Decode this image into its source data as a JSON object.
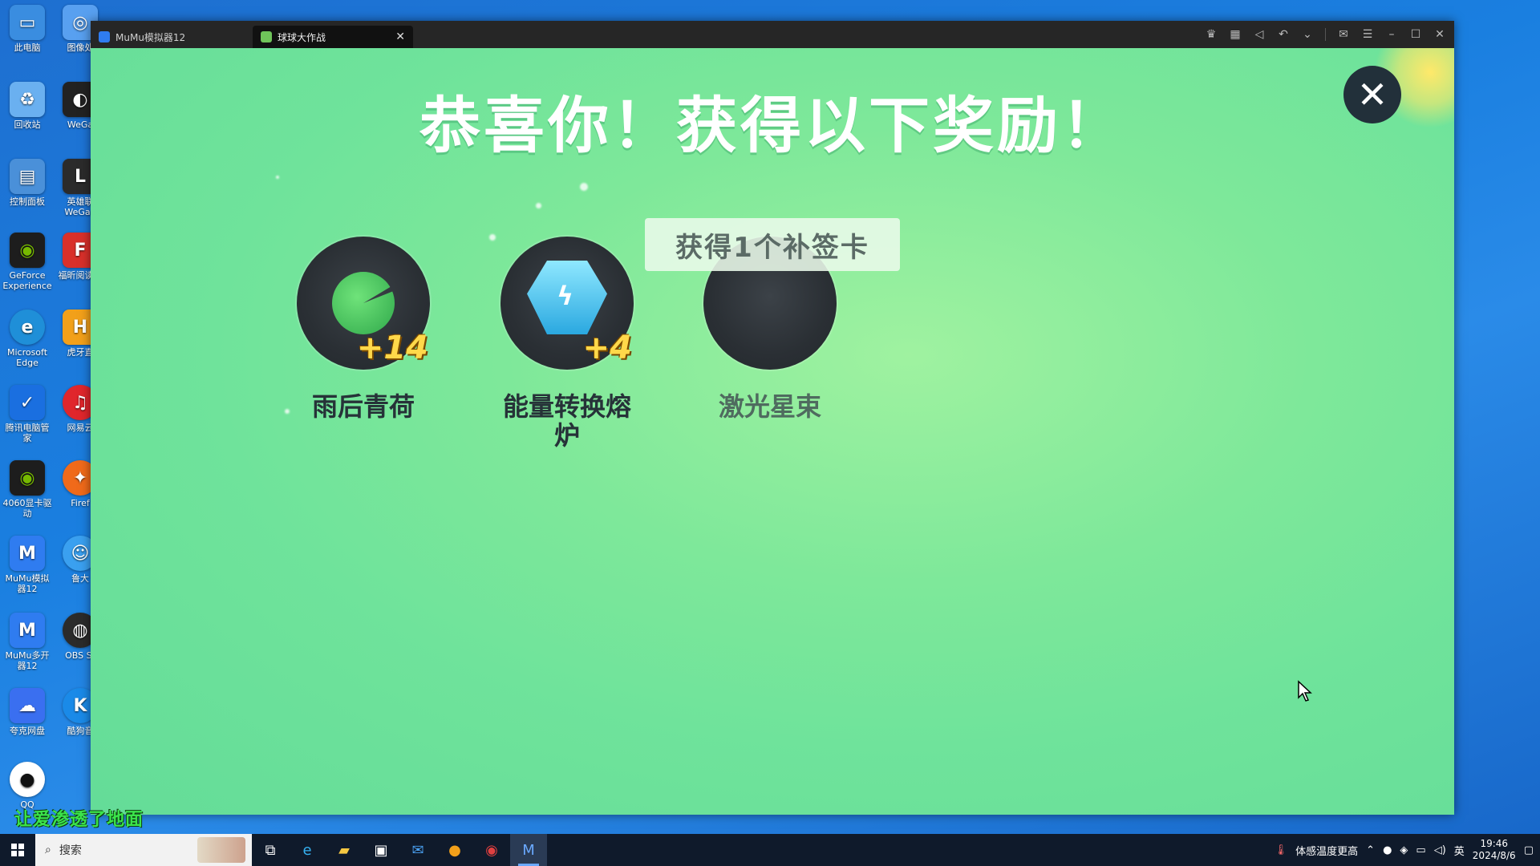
{
  "desktop": {
    "icons": [
      {
        "label": "此电脑",
        "color": "#3a8de0"
      },
      {
        "label": "图像处",
        "color": "#58a0f0"
      },
      {
        "label": "回收站",
        "color": "#6ab0f0"
      },
      {
        "label": "WeGa",
        "color": "#222222"
      },
      {
        "label": "控制面板",
        "color": "#4a90d9"
      },
      {
        "label": "英雄联 WeGan",
        "color": "#2b2b2b"
      },
      {
        "label": "GeForce Experience",
        "color": "#1d1d1d"
      },
      {
        "label": "福昕阅读器",
        "color": "#d9302a"
      },
      {
        "label": "Microsoft Edge",
        "color": "#1f8fd8"
      },
      {
        "label": "虎牙直",
        "color": "#f2a01a"
      },
      {
        "label": "腾讯电脑管家",
        "color": "#1a6fe0"
      },
      {
        "label": "网易云",
        "color": "#e0262c"
      },
      {
        "label": "4060显卡驱动",
        "color": "#1d1d1d"
      },
      {
        "label": "Firef",
        "color": "#f06a1a"
      },
      {
        "label": "MuMu模拟器12",
        "color": "#2f7cf0"
      },
      {
        "label": "鲁大",
        "color": "#3aa0f0"
      },
      {
        "label": "MuMu多开器12",
        "color": "#2f7cf0"
      },
      {
        "label": "OBS St",
        "color": "#2b2b2b"
      },
      {
        "label": "夸克网盘",
        "color": "#3a6ff0"
      },
      {
        "label": "酷狗音",
        "color": "#1a8ae8"
      },
      {
        "label": "QQ",
        "color": "#111111"
      }
    ]
  },
  "window": {
    "tabs": [
      {
        "label": "MuMu模拟器12"
      },
      {
        "label": "球球大作战"
      }
    ],
    "toolbar_icons": [
      "gamepad-icon",
      "keyboard-icon",
      "volume-icon",
      "undo-icon",
      "chevron-down-icon",
      "mail-icon",
      "menu-icon",
      "minimize-icon",
      "maximize-icon",
      "close-icon"
    ]
  },
  "game": {
    "headline": "恭喜你！获得以下奖励！",
    "close_glyph": "✕",
    "toast": "获得1个补签卡",
    "rewards": [
      {
        "name": "雨后青荷",
        "count": "+14"
      },
      {
        "name": "能量转换熔炉",
        "count": "+4"
      },
      {
        "name": "激光星束",
        "count": ""
      }
    ]
  },
  "overlay": {
    "caption": "让爱渗透了地面"
  },
  "taskbar": {
    "search_placeholder": "搜索",
    "weather_text": "体感温度更高",
    "ime": "英",
    "time": "19:46",
    "date": "2024/8/6"
  }
}
